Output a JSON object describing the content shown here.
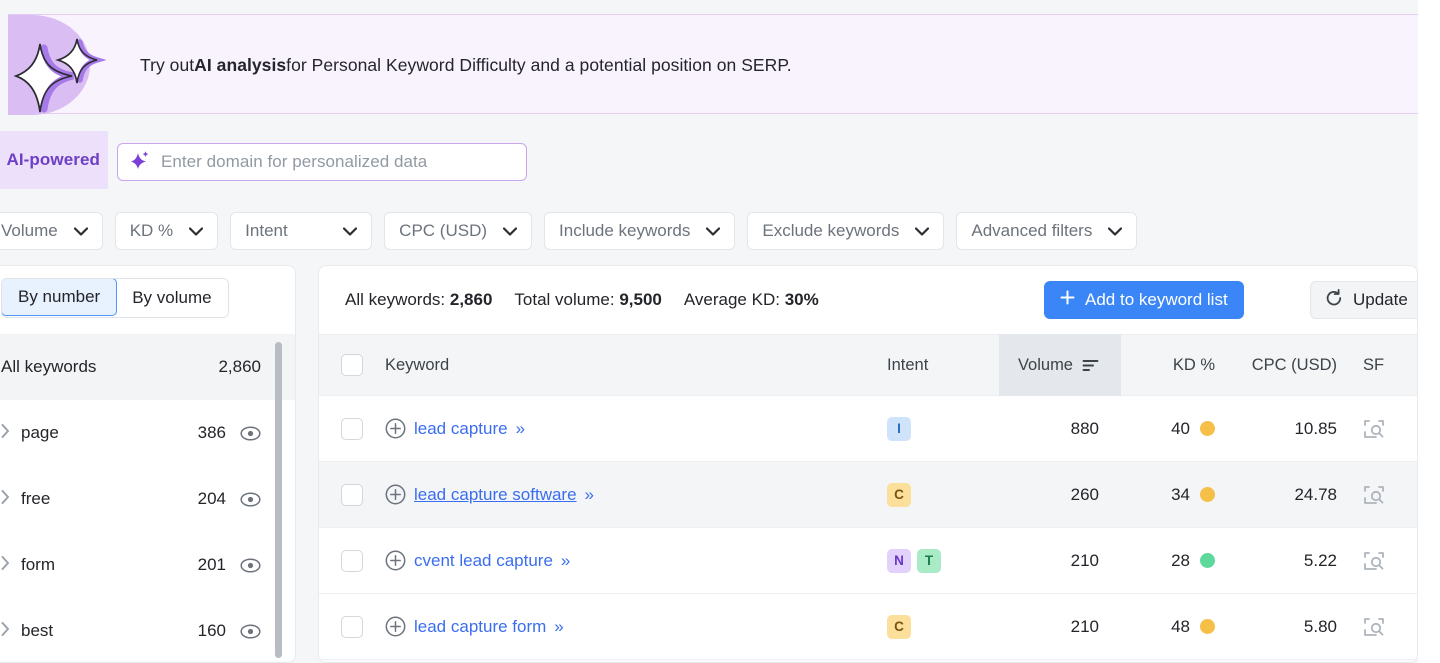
{
  "banner": {
    "text_prefix": "Try out ",
    "text_bold": "AI analysis",
    "text_suffix": " for Personal Keyword Difficulty and a potential position on SERP.",
    "sparkle_icon": "sparkle-icon",
    "accent_color": "#d9bdf3",
    "background_color": "#f9f3fe"
  },
  "ai_search": {
    "chip_label": "AI-powered",
    "chip_color": "#6d3fc4",
    "input_placeholder": "Enter domain for personalized data",
    "input_value": "",
    "sparkle_icon": "sparkle-icon"
  },
  "filters": [
    {
      "label": "Volume",
      "caret": "chevron-down-icon"
    },
    {
      "label": "KD %",
      "caret": "chevron-down-icon"
    },
    {
      "label": "Intent",
      "caret": "chevron-down-icon"
    },
    {
      "label": "CPC (USD)",
      "caret": "chevron-down-icon"
    },
    {
      "label": "Include keywords",
      "caret": "chevron-down-icon"
    },
    {
      "label": "Exclude keywords",
      "caret": "chevron-down-icon"
    },
    {
      "label": "Advanced filters",
      "caret": "chevron-down-icon"
    }
  ],
  "sidebar": {
    "segments": [
      {
        "label": "By number",
        "active": true
      },
      {
        "label": "By volume",
        "active": false
      }
    ],
    "all_row": {
      "label": "All keywords",
      "count": "2,860"
    },
    "groups": [
      {
        "label": "page",
        "count": "386",
        "eye_icon": "eye-icon",
        "chevron": "chevron-right-icon"
      },
      {
        "label": "free",
        "count": "204",
        "eye_icon": "eye-icon",
        "chevron": "chevron-right-icon"
      },
      {
        "label": "form",
        "count": "201",
        "eye_icon": "eye-icon",
        "chevron": "chevron-right-icon"
      },
      {
        "label": "best",
        "count": "160",
        "eye_icon": "eye-icon",
        "chevron": "chevron-right-icon"
      }
    ]
  },
  "main": {
    "stats": [
      {
        "label": "All keywords:",
        "value": "2,860"
      },
      {
        "label": "Total volume:",
        "value": "9,500"
      },
      {
        "label": "Average KD:",
        "value": "30%"
      }
    ],
    "add_button": {
      "label": "Add to keyword list",
      "icon": "plus-icon",
      "color": "#3a86f6"
    },
    "update_button": {
      "label": "Update",
      "icon": "refresh-icon"
    },
    "table": {
      "columns": [
        {
          "key": "checkbox",
          "label": ""
        },
        {
          "key": "keyword",
          "label": "Keyword"
        },
        {
          "key": "intent",
          "label": "Intent"
        },
        {
          "key": "volume",
          "label": "Volume",
          "sorted": true,
          "sort_icon": "sort-descending-icon"
        },
        {
          "key": "kd",
          "label": "KD %"
        },
        {
          "key": "cpc",
          "label": "CPC (USD)"
        },
        {
          "key": "sf",
          "label": "SF"
        }
      ],
      "rows": [
        {
          "keyword": "lead capture",
          "intent": [
            "I"
          ],
          "volume": "880",
          "kd": "40",
          "kd_color": "#f5bf48",
          "cpc": "10.85",
          "hovered": false,
          "expand_icon": "plus-circle-icon",
          "chevrons": "»",
          "sf_icon": "serp-feature-icon"
        },
        {
          "keyword": "lead capture software",
          "intent": [
            "C"
          ],
          "volume": "260",
          "kd": "34",
          "kd_color": "#f5bf48",
          "cpc": "24.78",
          "hovered": true,
          "expand_icon": "plus-circle-icon",
          "chevrons": "»",
          "sf_icon": "serp-feature-icon"
        },
        {
          "keyword": "cvent lead capture",
          "intent": [
            "N",
            "T"
          ],
          "volume": "210",
          "kd": "28",
          "kd_color": "#5fd99b",
          "cpc": "5.22",
          "hovered": false,
          "expand_icon": "plus-circle-icon",
          "chevrons": "»",
          "sf_icon": "serp-feature-icon"
        },
        {
          "keyword": "lead capture form",
          "intent": [
            "C"
          ],
          "volume": "210",
          "kd": "48",
          "kd_color": "#f5bf48",
          "cpc": "5.80",
          "hovered": false,
          "expand_icon": "plus-circle-icon",
          "chevrons": "»",
          "sf_icon": "serp-feature-icon"
        }
      ]
    }
  }
}
